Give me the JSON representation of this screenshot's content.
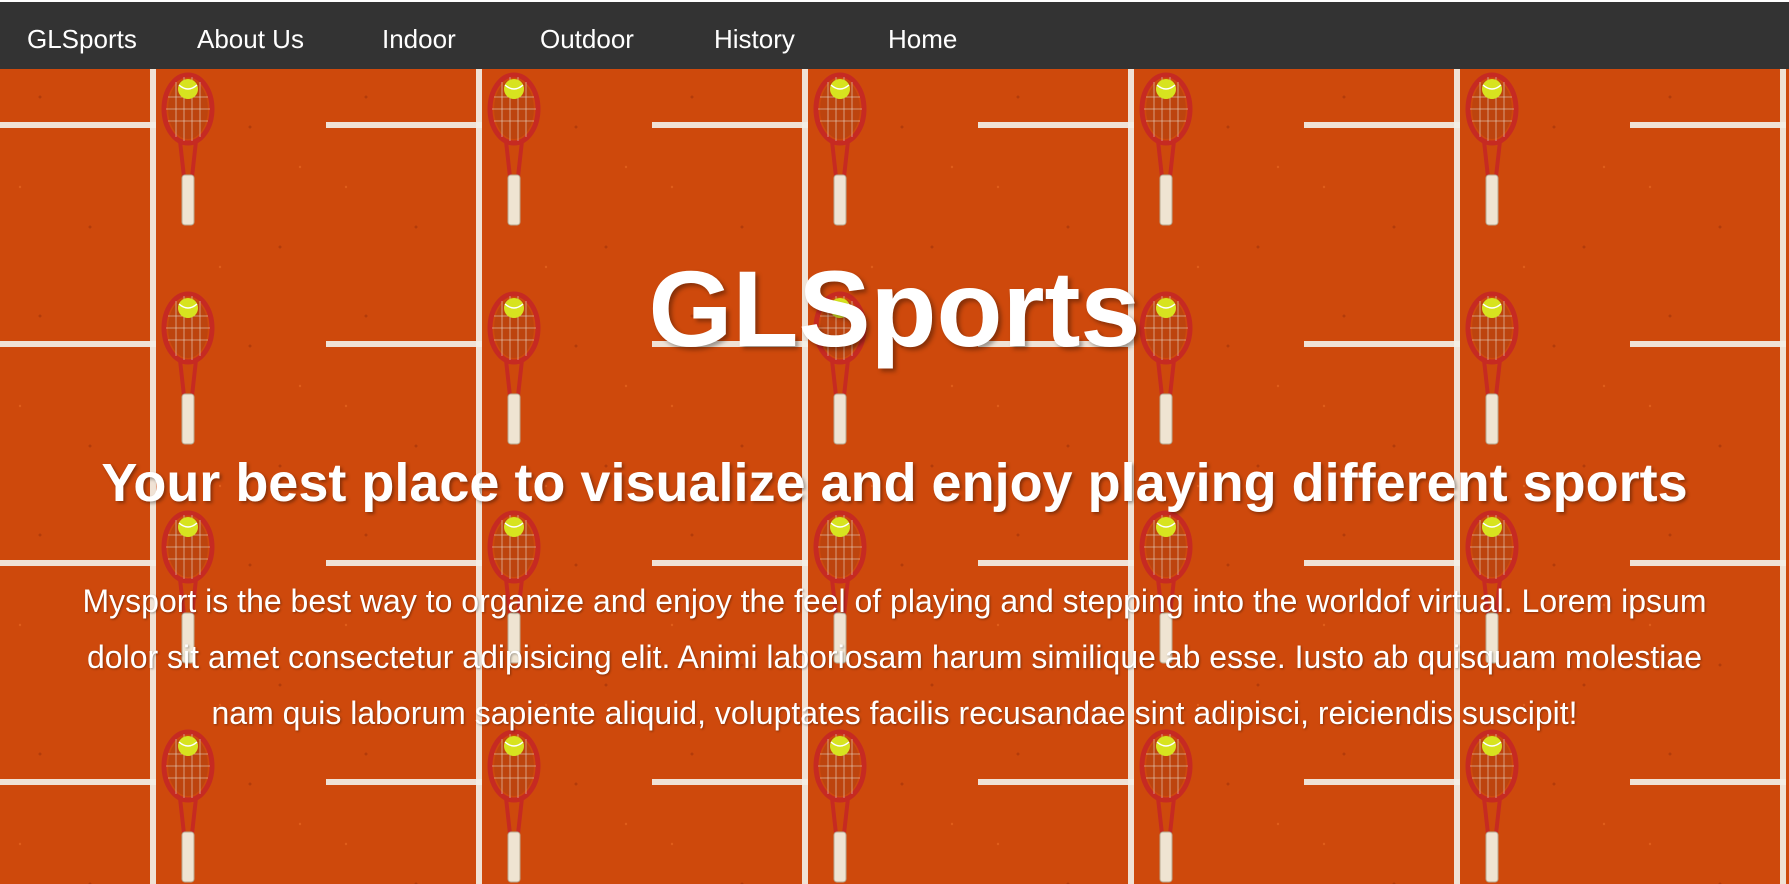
{
  "nav": {
    "brand": "GLSports",
    "items": [
      "About Us",
      "Indoor",
      "Outdoor",
      "History",
      "Home"
    ]
  },
  "hero": {
    "title": "GLSports",
    "subtitle": "Your best place to visualize and enjoy playing different sports",
    "text": "Mysport is the best way to organize and enjoy the feel of playing and stepping into the worldof virtual. Lorem ipsum dolor sit amet consectetur adipisicing elit. Animi laboriosam harum similique ab esse. Iusto ab quisquam molestiae nam quis laborum sapiente aliquid, voluptates facilis recusandae sint adipisci, reiciendis suscipit!"
  },
  "colors": {
    "nav_bg": "#333333",
    "clay": "#c9440b",
    "text": "#ffffff"
  },
  "icons": {
    "background_tile": "tennis-racket-ball-clay-court"
  }
}
